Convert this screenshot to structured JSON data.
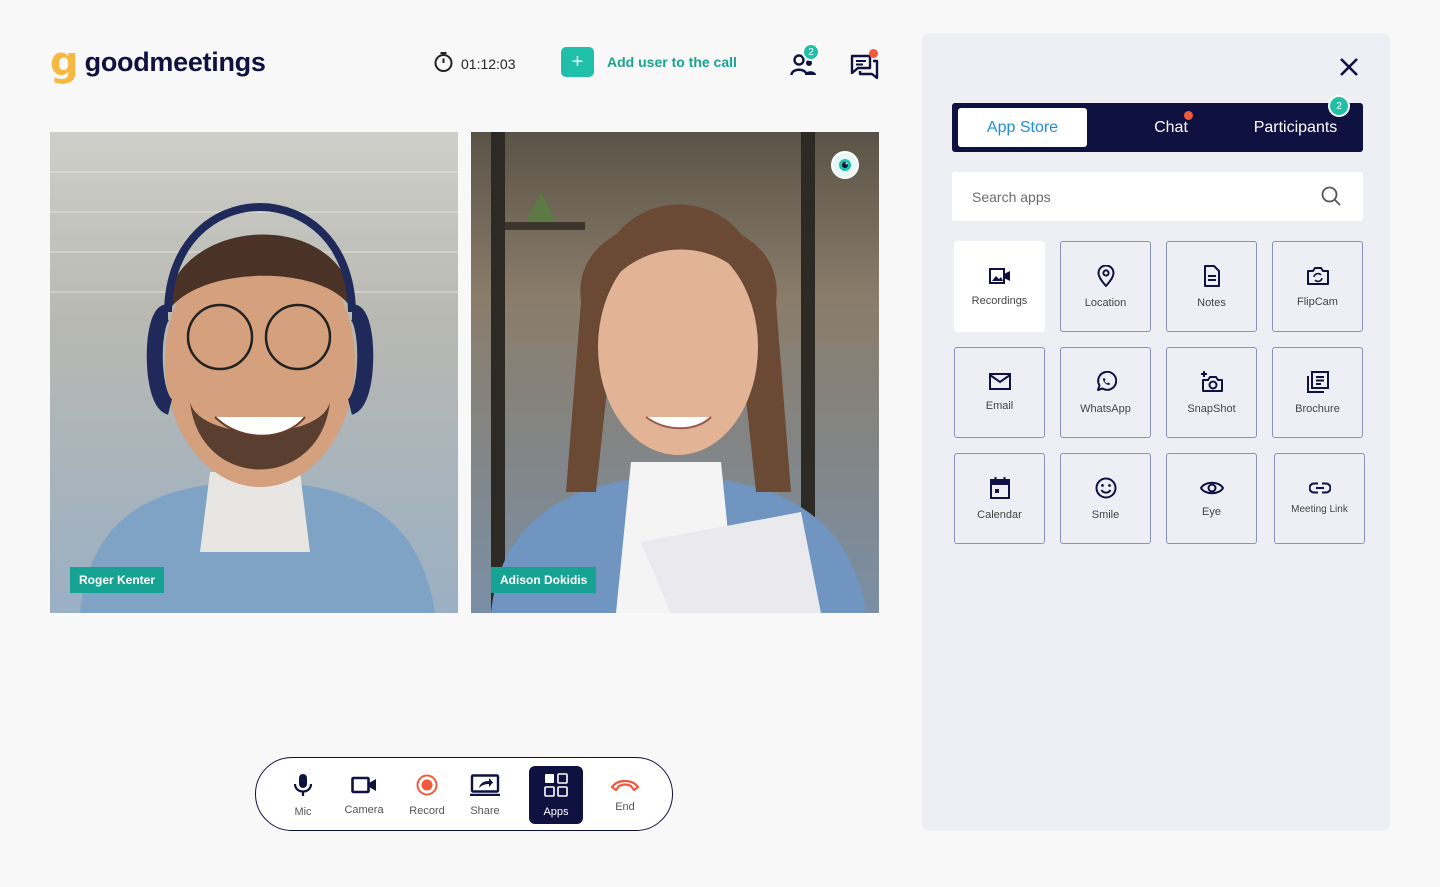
{
  "header": {
    "logo_mark": "g",
    "logo_text": "goodmeetings",
    "timer": "01:12:03",
    "add_user_label": "Add  user to the call",
    "add_user_icon": "+",
    "participants_count": "2"
  },
  "participants": [
    {
      "name": "Roger Kenter"
    },
    {
      "name": "Adison Dokidis"
    }
  ],
  "controls": [
    {
      "label": "Mic",
      "icon": "mic-icon"
    },
    {
      "label": "Camera",
      "icon": "camera-icon"
    },
    {
      "label": "Record",
      "icon": "record-icon"
    },
    {
      "label": "Share",
      "icon": "share-icon"
    },
    {
      "label": "Apps",
      "icon": "apps-icon",
      "active": true
    },
    {
      "label": "End",
      "icon": "end-call-icon"
    }
  ],
  "panel": {
    "tabs": [
      {
        "label": "App Store",
        "active": true
      },
      {
        "label": "Chat"
      },
      {
        "label": "Participants",
        "badge": "2"
      }
    ],
    "search_placeholder": "Search apps",
    "apps": [
      {
        "label": "Recordings",
        "icon": "recordings-icon"
      },
      {
        "label": "Location",
        "icon": "location-icon"
      },
      {
        "label": "Notes",
        "icon": "notes-icon"
      },
      {
        "label": "FlipCam",
        "icon": "flipcam-icon"
      },
      {
        "label": "Email",
        "icon": "email-icon"
      },
      {
        "label": "WhatsApp",
        "icon": "whatsapp-icon"
      },
      {
        "label": "SnapShot",
        "icon": "snapshot-icon"
      },
      {
        "label": "Brochure",
        "icon": "brochure-icon"
      },
      {
        "label": "Calendar",
        "icon": "calendar-icon"
      },
      {
        "label": "Smile",
        "icon": "smile-icon"
      },
      {
        "label": "Eye",
        "icon": "eye-icon"
      },
      {
        "label": "Meeting Link",
        "icon": "link-icon"
      }
    ]
  },
  "colors": {
    "brand_navy": "#0f1140",
    "accent_teal": "#20c0a8",
    "logo_yellow": "#f5b942",
    "alert_red": "#f0593b",
    "tab_active_text": "#1d8fd8"
  }
}
